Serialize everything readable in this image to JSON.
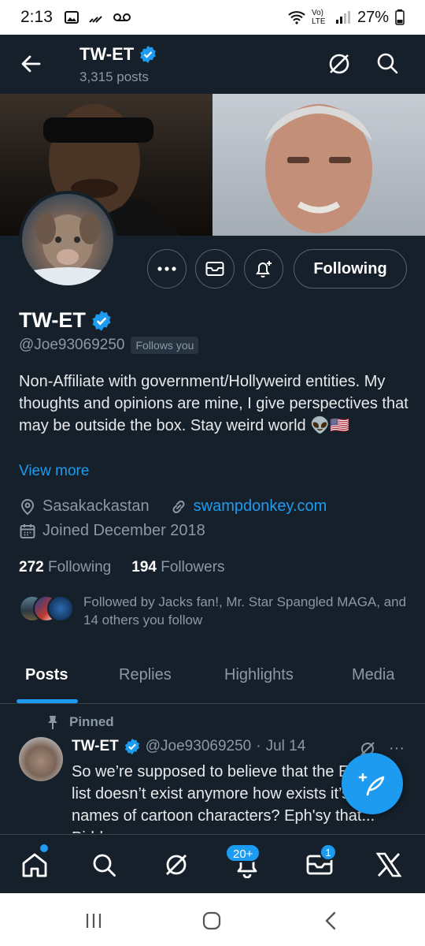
{
  "status_bar": {
    "time": "2:13",
    "signal_label": "Vo) LTE",
    "battery": "27%"
  },
  "header": {
    "title": "TW-ET",
    "post_count": "3,315 posts"
  },
  "profile": {
    "name": "TW-ET",
    "handle": "@Joe93069250",
    "follows_you": "Follows you",
    "bio": "Non-Affiliate with government/Hollyweird entities. My thoughts and opinions are mine, I give perspectives that may be outside the box.  Stay weird world 👽🇺🇸",
    "view_more": "View more",
    "location": "Sasakackastan",
    "website": "swampdonkey.com",
    "joined": "Joined December 2018",
    "following_count": "272",
    "following_label": "Following",
    "followers_count": "194",
    "followers_label": "Followers",
    "followed_by": "Followed by Jacks fan!, Mr. Star Spangled MAGA, and 14 others you follow",
    "following_button": "Following"
  },
  "tabs": [
    {
      "label": "Posts",
      "active": true
    },
    {
      "label": "Replies",
      "active": false
    },
    {
      "label": "Highlights",
      "active": false
    },
    {
      "label": "Media",
      "active": false
    }
  ],
  "pinned_post": {
    "pinned_label": "Pinned",
    "author": "TW-ET",
    "handle": "@Joe93069250",
    "separator": "·",
    "date": "Jul 14",
    "text": "So we’re supposed to believe that the Epstein list doesn’t exist anymore how exists it’s full of names of cartoon characters? Eph'sy that... Piddy..."
  },
  "bottom_nav": {
    "notifications_badge": "20+",
    "messages_badge": "1"
  },
  "colors": {
    "background": "#15202b",
    "accent": "#1d9bf0",
    "muted_text": "#8b98a5",
    "border": "#536471"
  },
  "icons": [
    "back-arrow-icon",
    "grok-icon",
    "search-icon",
    "more-icon",
    "mail-icon",
    "bell-plus-icon",
    "verified-badge-icon",
    "location-icon",
    "link-icon",
    "calendar-icon",
    "pin-icon",
    "compose-icon",
    "home-icon",
    "bell-icon",
    "x-logo-icon"
  ]
}
